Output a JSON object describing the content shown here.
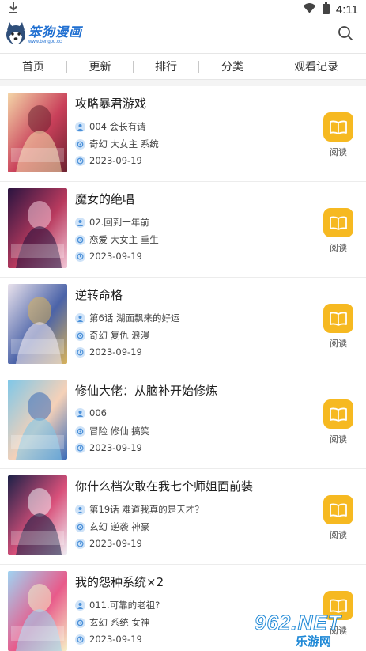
{
  "status": {
    "time": "4:11"
  },
  "app": {
    "logo_title": "笨狗漫画",
    "logo_url": "www.bengou.cc"
  },
  "tabs": [
    "首页",
    "更新",
    "排行",
    "分类",
    "观看记录"
  ],
  "read_label": "阅读",
  "comics": [
    {
      "title": "攻略暴君游戏",
      "chapter": "004 会长有请",
      "tags": "奇幻 大女主 系统",
      "date": "2023-09-19",
      "cover_colors": [
        "#f4d6a8",
        "#c9405a",
        "#6b2230"
      ]
    },
    {
      "title": "魔女的绝唱",
      "chapter": "02.回到一年前",
      "tags": "恋爱 大女主 重生",
      "date": "2023-09-19",
      "cover_colors": [
        "#2a1440",
        "#b83a5e",
        "#f3c8d8"
      ]
    },
    {
      "title": "逆转命格",
      "chapter": "第6话 湖面飘来的好运",
      "tags": "奇幻 复仇 浪漫",
      "date": "2023-09-19",
      "cover_colors": [
        "#e9e2ec",
        "#4b63a8",
        "#d9b35a"
      ]
    },
    {
      "title": "修仙大佬：从脑补开始修炼",
      "chapter": "006",
      "tags": "冒险 修仙 搞笑",
      "date": "2023-09-19",
      "cover_colors": [
        "#7fc7e8",
        "#f5d1b8",
        "#3a6bb8"
      ]
    },
    {
      "title": "你什么档次敢在我七个师姐面前装",
      "chapter": "第19话 难道我真的是天才？",
      "tags": "玄幻 逆袭 神豪",
      "date": "2023-09-19",
      "cover_colors": [
        "#1d2148",
        "#d8507a",
        "#f0f0f6"
      ]
    },
    {
      "title": "我的怨种系统×2",
      "chapter": "011.可靠的老祖?",
      "tags": "玄幻 系统 女神",
      "date": "2023-09-19",
      "cover_colors": [
        "#9fd3f2",
        "#e85a8a",
        "#f6f1c6"
      ]
    }
  ],
  "watermark": {
    "number": "962.NET",
    "text": "乐游网"
  }
}
